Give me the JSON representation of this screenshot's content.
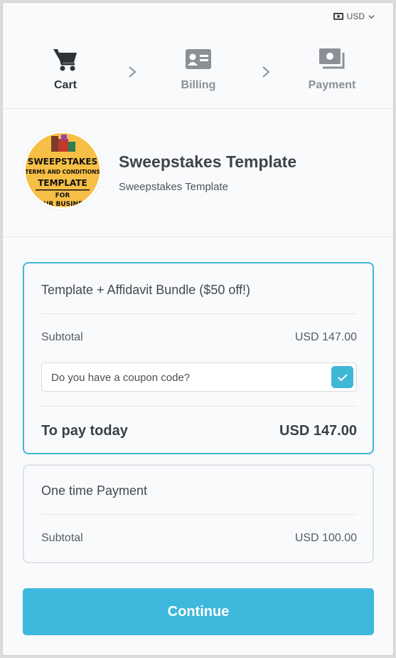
{
  "currency": {
    "label": "USD"
  },
  "steps": [
    {
      "label": "Cart",
      "icon": "cart-icon",
      "active": true
    },
    {
      "label": "Billing",
      "icon": "id-card-icon",
      "active": false
    },
    {
      "label": "Payment",
      "icon": "cash-icon",
      "active": false
    }
  ],
  "product": {
    "title": "Sweepstakes Template",
    "subtitle": "Sweepstakes Template",
    "thumb_lines": [
      "SWEEPSTAKES",
      "TERMS AND CONDITIONS",
      "TEMPLATE",
      "FOR",
      "YOUR BUSINESS"
    ]
  },
  "options": [
    {
      "name": "Template + Affidavit Bundle ($50 off!)",
      "subtotal_label": "Subtotal",
      "subtotal_value": "USD 147.00",
      "coupon_text": "Do you have a coupon code?",
      "coupon_checked": true,
      "total_label": "To pay today",
      "total_value": "USD 147.00",
      "selected": true
    },
    {
      "name": "One time Payment",
      "subtotal_label": "Subtotal",
      "subtotal_value": "USD 100.00",
      "selected": false
    }
  ],
  "continue_label": "Continue",
  "colors": {
    "accent": "#3fb8dd",
    "text": "#3f4348",
    "muted": "#8b9096"
  }
}
